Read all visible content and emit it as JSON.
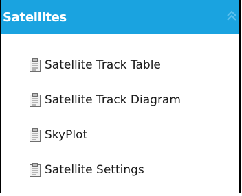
{
  "panel": {
    "title": "Satellites",
    "collapse_icon": "double-chevron-up-icon",
    "header_color": "#1aa3e0"
  },
  "menu": {
    "items": [
      {
        "label": "Satellite Track Table",
        "icon": "document-icon"
      },
      {
        "label": "Satellite Track Diagram",
        "icon": "document-icon"
      },
      {
        "label": "SkyPlot",
        "icon": "document-icon"
      },
      {
        "label": "Satellite Settings",
        "icon": "document-icon"
      }
    ]
  }
}
